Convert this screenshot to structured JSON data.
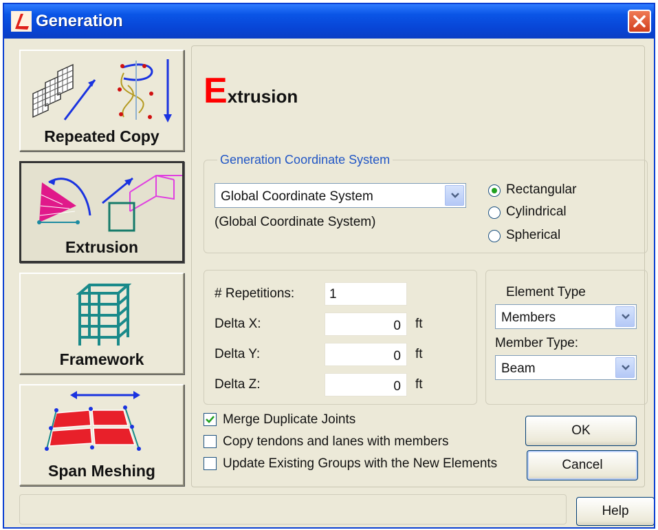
{
  "window": {
    "title": "Generation",
    "close_glyph": "✕"
  },
  "nav": [
    {
      "label": "Repeated Copy",
      "icon": "repeated-copy-icon"
    },
    {
      "label": "Extrusion",
      "icon": "extrusion-icon",
      "selected": true
    },
    {
      "label": "Framework",
      "icon": "framework-icon"
    },
    {
      "label": "Span Meshing",
      "icon": "span-meshing-icon"
    }
  ],
  "heading": {
    "initial": "E",
    "rest": "xtrusion"
  },
  "coordinate_system": {
    "group_label": "Generation Coordinate System",
    "selected": "Global Coordinate System",
    "caption": "(Global Coordinate System)",
    "radios": [
      {
        "label": "Rectangular",
        "checked": true
      },
      {
        "label": "Cylindrical",
        "checked": false
      },
      {
        "label": "Spherical",
        "checked": false
      }
    ]
  },
  "params": {
    "repetitions_label": "# Repetitions:",
    "repetitions_value": "1",
    "delta_x_label": "Delta X:",
    "delta_x_value": "0",
    "delta_y_label": "Delta Y:",
    "delta_y_value": "0",
    "delta_z_label": "Delta Z:",
    "delta_z_value": "0",
    "unit": "ft"
  },
  "element": {
    "element_type_label": "Element Type",
    "element_type_value": "Members",
    "member_type_label": "Member Type:",
    "member_type_value": "Beam"
  },
  "options": [
    {
      "label": "Merge Duplicate Joints",
      "checked": true
    },
    {
      "label": "Copy tendons and lanes with members",
      "checked": false
    },
    {
      "label": "Update Existing Groups with the New Elements",
      "checked": false
    }
  ],
  "buttons": {
    "ok": "OK",
    "cancel": "Cancel",
    "help": "Help"
  },
  "colors": {
    "title_bar": "#0a55e6",
    "heading_initial": "#ff0000",
    "group_label": "#2156c5",
    "radio_dot": "#21a121"
  }
}
